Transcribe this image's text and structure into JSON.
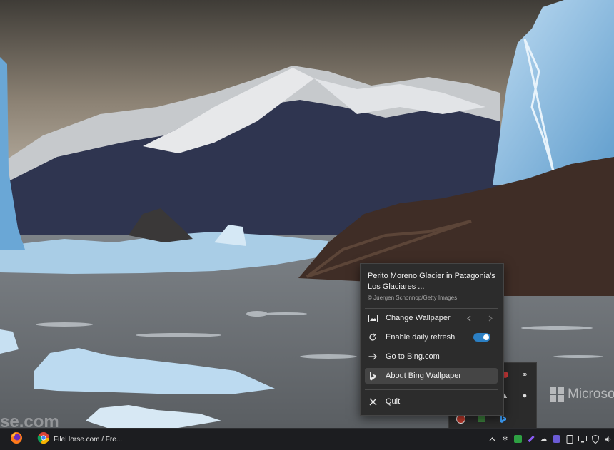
{
  "menu": {
    "title": "Perito Moreno Glacier in Patagonia's Los Glaciares ...",
    "credit": "© Juergen Schonnop/Getty Images",
    "items": [
      {
        "label": "Change Wallpaper",
        "icon": "image-icon"
      },
      {
        "label": "Enable daily refresh",
        "icon": "refresh-icon",
        "toggle_on": true
      },
      {
        "label": "Go to Bing.com",
        "icon": "arrow-right-icon"
      },
      {
        "label": "About Bing Wallpaper",
        "icon": "bing-icon",
        "highlighted": true
      },
      {
        "label": "Quit",
        "icon": "close-icon"
      }
    ]
  },
  "taskbar": {
    "apps": [
      {
        "icon": "firefox-icon"
      },
      {
        "icon": "chrome-icon",
        "label": "FileHorse.com / Fre..."
      }
    ],
    "tray_icons": [
      "chevron-up-icon",
      "settings-icon",
      "shield-check-icon",
      "feather-icon",
      "cloud-icon",
      "messenger-icon",
      "display-icon",
      "network-icon",
      "volume-icon"
    ]
  },
  "watermarks": {
    "microsoft": "Microso",
    "filehorse": "se.com"
  },
  "colors": {
    "accent": "#2b7fc3",
    "menu_bg": "#2c2c2c",
    "taskbar_bg": "#1c1d20"
  }
}
